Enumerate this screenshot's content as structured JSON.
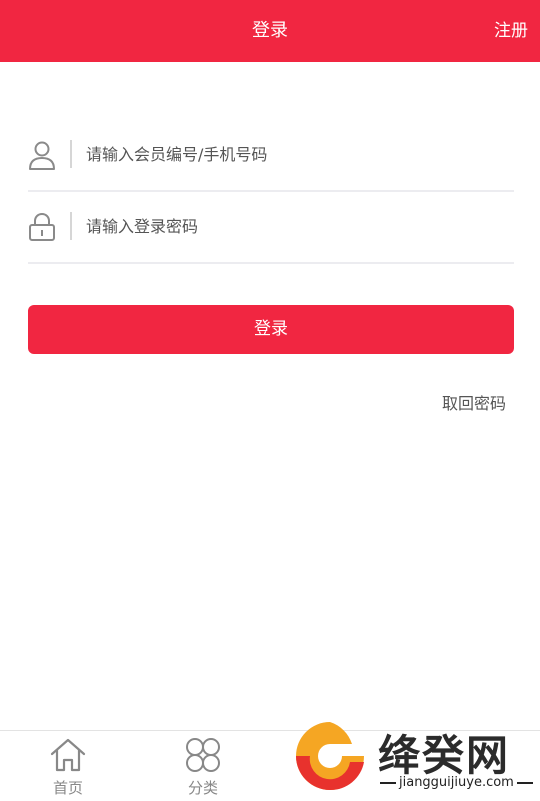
{
  "header": {
    "title": "登录",
    "register_label": "注册",
    "background_color": "#f12641"
  },
  "form": {
    "account_placeholder": "请输入会员编号/手机号码",
    "password_placeholder": "请输入登录密码",
    "account_icon": "user-icon",
    "password_icon": "lock-icon",
    "login_label": "登录",
    "retrieve_password_label": "取回密码"
  },
  "tabbar": {
    "items": [
      {
        "label": "首页",
        "icon": "home-icon"
      },
      {
        "label": "分类",
        "icon": "category-icon"
      }
    ]
  },
  "watermark": {
    "text": "绛癸网",
    "subtext": "jiangguijiuye.com",
    "logo_colors": [
      "#f5a623",
      "#e8322d"
    ]
  }
}
